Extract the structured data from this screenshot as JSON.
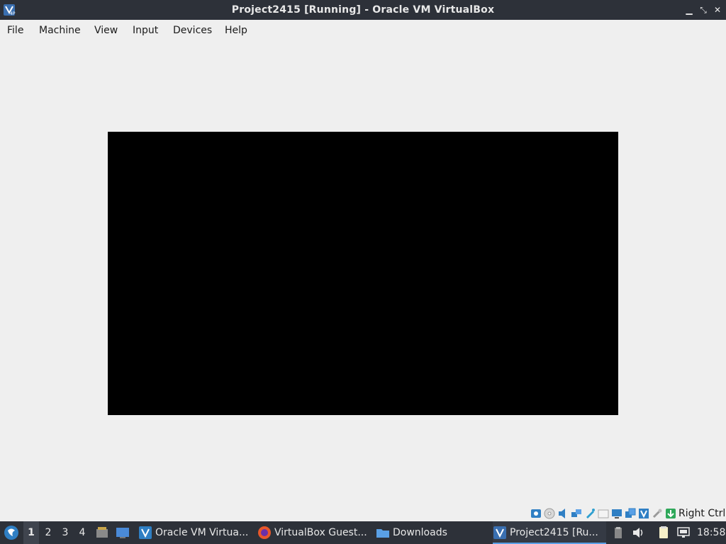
{
  "window": {
    "title": "Project2415 [Running] - Oracle VM VirtualBox"
  },
  "menubar": {
    "items": [
      "File",
      "Machine",
      "View",
      "Input",
      "Devices",
      "Help"
    ]
  },
  "statusbar": {
    "icons": [
      "hard-disk-icon",
      "optical-drive-icon",
      "audio-icon",
      "network-icon",
      "usb-icon",
      "shared-folders-icon",
      "display-icon",
      "video-capture-icon",
      "virtualization-icon",
      "mouse-integration-icon",
      "keyboard-capture-icon"
    ],
    "host_key": "Right Ctrl"
  },
  "taskbar": {
    "workspaces": [
      "1",
      "2",
      "3",
      "4"
    ],
    "active_workspace": "1",
    "tasks": [
      {
        "label": "Oracle VM Virtua...",
        "icon": "virtualbox-manager-icon"
      },
      {
        "label": "VirtualBox Guest...",
        "icon": "firefox-icon"
      },
      {
        "label": "Downloads",
        "icon": "folder-icon"
      },
      {
        "label": "Project2415 [Ru...",
        "icon": "virtualbox-vm-icon",
        "active": true
      }
    ],
    "clock": "18:58"
  },
  "colors": {
    "titlebar_bg": "#2d3139",
    "window_bg": "#efefef",
    "vm_screen": "#000000",
    "taskbar_bg": "#2d3139",
    "accent": "#5aa0e6"
  }
}
